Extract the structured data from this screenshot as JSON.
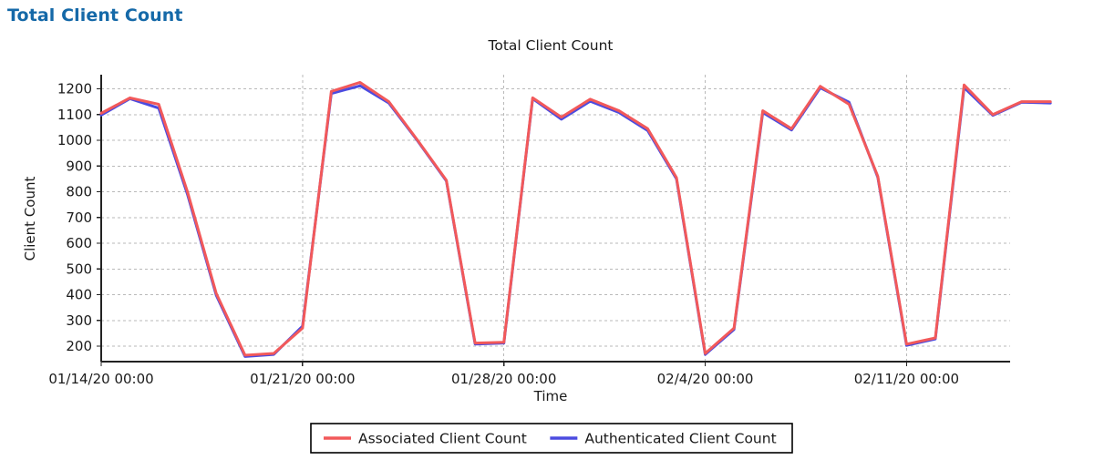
{
  "page": {
    "title": "Total Client Count",
    "title_color": "#1569a8"
  },
  "chart_data": {
    "type": "line",
    "title": "Total Client Count",
    "xlabel": "Time",
    "ylabel": "Client Count",
    "grid": true,
    "legend_position": "bottom-center",
    "ylim": [
      140,
      1255
    ],
    "yticks": [
      200,
      300,
      400,
      500,
      600,
      700,
      800,
      900,
      1000,
      1100,
      1200
    ],
    "ytick_labels": [
      "200",
      "300",
      "400",
      "500",
      "600",
      "700",
      "800",
      "900",
      "1000",
      "1100",
      "1200"
    ],
    "xtick_labels": [
      "01/14/20 00:00",
      "01/21/20 00:00",
      "01/28/20 00:00",
      "02/4/20 00:00",
      "02/11/20 00:00"
    ],
    "xtick_positions": [
      0,
      7,
      14,
      21,
      28
    ],
    "xlim": [
      0,
      31.6
    ],
    "x": [
      0,
      1,
      2,
      3,
      4,
      5,
      6,
      7,
      8,
      9,
      10,
      11,
      12,
      13,
      14,
      15,
      16,
      17,
      18,
      19,
      20,
      21,
      22,
      23,
      24,
      25,
      26,
      27,
      28,
      29,
      30,
      31
    ],
    "series": [
      {
        "name": "Associated Client Count",
        "color": "#f2595a",
        "values": [
          1105,
          1165,
          1140,
          800,
          405,
          165,
          172,
          270,
          1190,
          1225,
          1150,
          1000,
          845,
          212,
          215,
          1165,
          1090,
          1160,
          1115,
          1045,
          855,
          172,
          270,
          1115,
          1045,
          1210,
          1140,
          860,
          208,
          232,
          1215,
          1100,
          1150,
          1150
        ]
      },
      {
        "name": "Authenticated Client Count",
        "color": "#4b4be0",
        "values": [
          1098,
          1162,
          1125,
          790,
          398,
          160,
          168,
          278,
          1182,
          1212,
          1145,
          998,
          842,
          208,
          212,
          1162,
          1082,
          1152,
          1108,
          1038,
          850,
          168,
          265,
          1108,
          1040,
          1204,
          1148,
          856,
          203,
          228,
          1205,
          1097,
          1148,
          1145
        ]
      }
    ]
  },
  "legend": {
    "items": [
      {
        "label": "Associated Client Count",
        "color": "#f2595a"
      },
      {
        "label": "Authenticated Client Count",
        "color": "#4b4be0"
      }
    ]
  }
}
